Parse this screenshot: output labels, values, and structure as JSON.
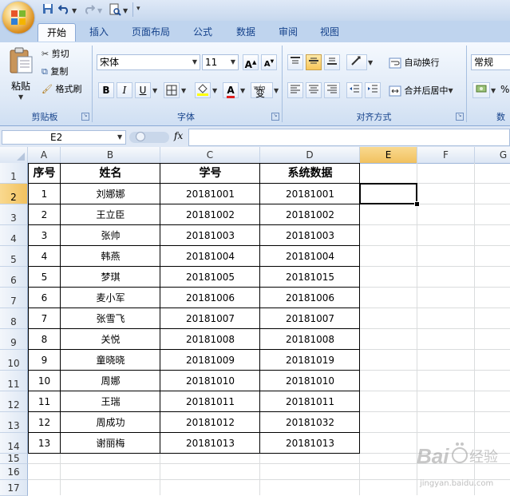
{
  "quick_access": {
    "save_icon": "save-icon",
    "undo_icon": "undo-icon",
    "redo_icon": "redo-icon",
    "print_preview_icon": "print-preview-icon",
    "customize_icon": "dropdown-arrow-icon"
  },
  "tabs": [
    {
      "label": "开始",
      "active": true
    },
    {
      "label": "插入"
    },
    {
      "label": "页面布局"
    },
    {
      "label": "公式"
    },
    {
      "label": "数据"
    },
    {
      "label": "审阅"
    },
    {
      "label": "视图"
    }
  ],
  "ribbon": {
    "clipboard": {
      "paste_label": "粘贴",
      "cut_label": "剪切",
      "copy_label": "复制",
      "format_painter_label": "格式刷",
      "group_label": "剪贴板"
    },
    "font": {
      "font_name": "宋体",
      "font_size": "11",
      "bold": "B",
      "italic": "I",
      "underline": "U",
      "phonetic": "wén",
      "phonetic_char": "变",
      "font_color_letter": "A",
      "group_label": "字体"
    },
    "alignment": {
      "wrap_text_label": "自动换行",
      "merge_center_label": "合并后居中",
      "group_label": "对齐方式"
    },
    "number": {
      "format": "常规",
      "percent": "%",
      "group_label": "数"
    }
  },
  "formula_bar": {
    "name_box": "E2",
    "fx_label": "fx",
    "formula": ""
  },
  "sheet": {
    "columns": [
      "A",
      "B",
      "C",
      "D",
      "E",
      "F",
      "G"
    ],
    "selected_column": "E",
    "rows": [
      "1",
      "2",
      "3",
      "4",
      "5",
      "6",
      "7",
      "8",
      "9",
      "10",
      "11",
      "12",
      "13",
      "14",
      "15",
      "16",
      "17"
    ],
    "selected_row": "2",
    "selected_cell": "E2",
    "headers": [
      "序号",
      "姓名",
      "学号",
      "系统数据"
    ],
    "data": [
      [
        "1",
        "刘娜娜",
        "20181001",
        "20181001"
      ],
      [
        "2",
        "王立臣",
        "20181002",
        "20181002"
      ],
      [
        "3",
        "张帅",
        "20181003",
        "20181003"
      ],
      [
        "4",
        "韩燕",
        "20181004",
        "20181004"
      ],
      [
        "5",
        "梦琪",
        "20181005",
        "20181015"
      ],
      [
        "6",
        "麦小军",
        "20181006",
        "20181006"
      ],
      [
        "7",
        "张雪飞",
        "20181007",
        "20181007"
      ],
      [
        "8",
        "关悦",
        "20181008",
        "20181008"
      ],
      [
        "9",
        "童晓晓",
        "20181009",
        "20181019"
      ],
      [
        "10",
        "周娜",
        "20181010",
        "20181010"
      ],
      [
        "11",
        "王瑞",
        "20181011",
        "20181011"
      ],
      [
        "12",
        "周成功",
        "20181012",
        "20181032"
      ],
      [
        "13",
        "谢丽梅",
        "20181013",
        "20181013"
      ]
    ]
  },
  "watermark": {
    "brand": "Bai",
    "brand_tail": "经验",
    "url": "jingyan.baidu.com"
  }
}
